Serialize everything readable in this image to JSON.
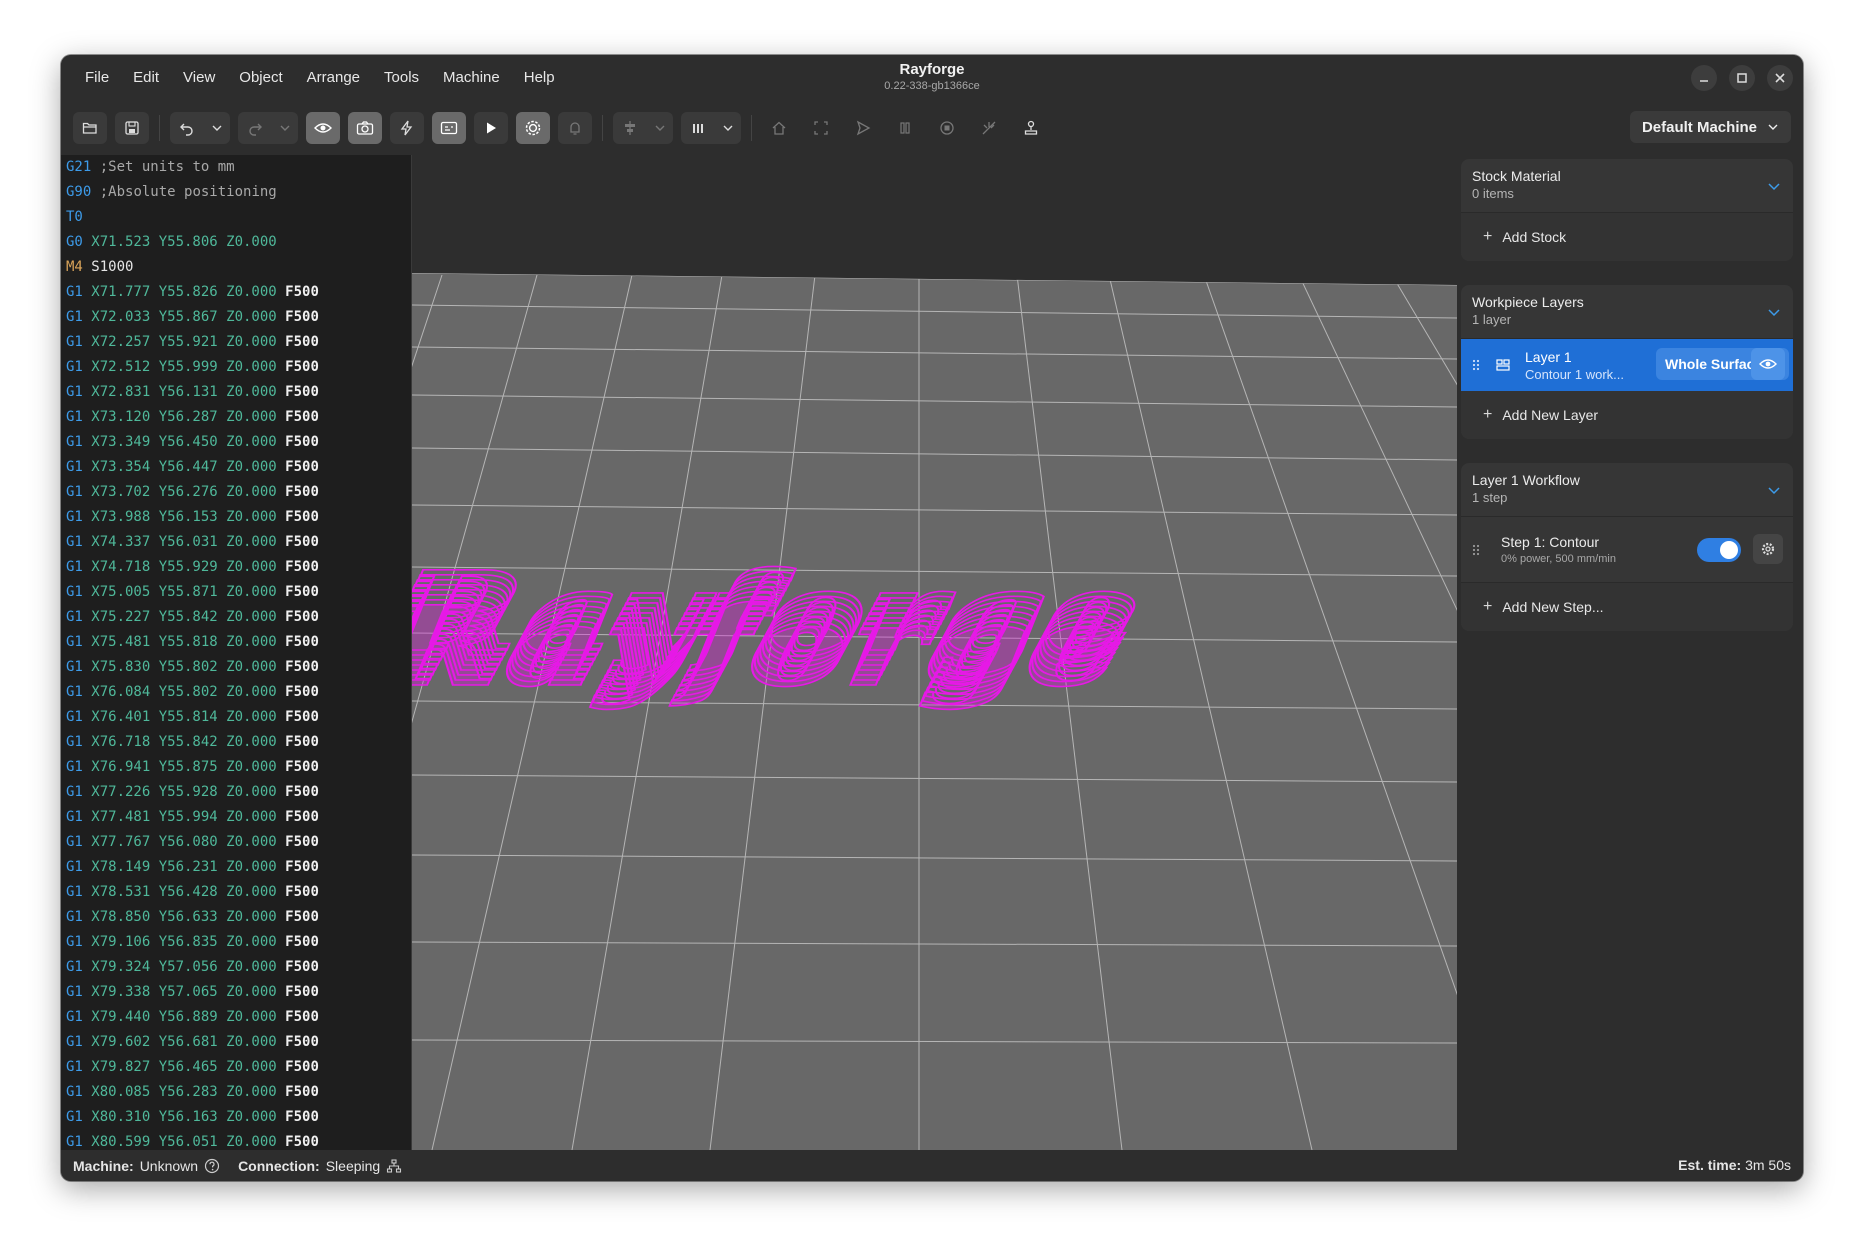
{
  "window": {
    "title": "Rayforge",
    "subtitle": "0.22-338-gb1366ce"
  },
  "menu": [
    "File",
    "Edit",
    "View",
    "Object",
    "Arrange",
    "Tools",
    "Machine",
    "Help"
  ],
  "toolbar": {
    "machine_select": "Default Machine"
  },
  "gcode": {
    "lines": [
      {
        "cmd": "G21",
        "cmd_color": "blue",
        "rest": " ;Set units to mm",
        "rest_color": "gray",
        "feed": ""
      },
      {
        "cmd": "G90",
        "cmd_color": "blue",
        "rest": " ;Absolute positioning",
        "rest_color": "gray",
        "feed": ""
      },
      {
        "cmd": "T0",
        "cmd_color": "blue",
        "rest": "",
        "rest_color": "green",
        "feed": ""
      },
      {
        "cmd": "G0",
        "cmd_color": "blue",
        "rest": " X71.523 Y55.806 Z0.000",
        "rest_color": "green",
        "feed": ""
      },
      {
        "cmd": "M4",
        "cmd_color": "orange",
        "rest": " S1000",
        "rest_color": "plain",
        "feed": ""
      },
      {
        "cmd": "G1",
        "cmd_color": "blue",
        "rest": " X71.777 Y55.826 Z0.000",
        "rest_color": "green",
        "feed": " F500"
      },
      {
        "cmd": "G1",
        "cmd_color": "blue",
        "rest": " X72.033 Y55.867 Z0.000",
        "rest_color": "green",
        "feed": " F500"
      },
      {
        "cmd": "G1",
        "cmd_color": "blue",
        "rest": " X72.257 Y55.921 Z0.000",
        "rest_color": "green",
        "feed": " F500"
      },
      {
        "cmd": "G1",
        "cmd_color": "blue",
        "rest": " X72.512 Y55.999 Z0.000",
        "rest_color": "green",
        "feed": " F500"
      },
      {
        "cmd": "G1",
        "cmd_color": "blue",
        "rest": " X72.831 Y56.131 Z0.000",
        "rest_color": "green",
        "feed": " F500"
      },
      {
        "cmd": "G1",
        "cmd_color": "blue",
        "rest": " X73.120 Y56.287 Z0.000",
        "rest_color": "green",
        "feed": " F500"
      },
      {
        "cmd": "G1",
        "cmd_color": "blue",
        "rest": " X73.349 Y56.450 Z0.000",
        "rest_color": "green",
        "feed": " F500"
      },
      {
        "cmd": "G1",
        "cmd_color": "blue",
        "rest": " X73.354 Y56.447 Z0.000",
        "rest_color": "green",
        "feed": " F500"
      },
      {
        "cmd": "G1",
        "cmd_color": "blue",
        "rest": " X73.702 Y56.276 Z0.000",
        "rest_color": "green",
        "feed": " F500"
      },
      {
        "cmd": "G1",
        "cmd_color": "blue",
        "rest": " X73.988 Y56.153 Z0.000",
        "rest_color": "green",
        "feed": " F500"
      },
      {
        "cmd": "G1",
        "cmd_color": "blue",
        "rest": " X74.337 Y56.031 Z0.000",
        "rest_color": "green",
        "feed": " F500"
      },
      {
        "cmd": "G1",
        "cmd_color": "blue",
        "rest": " X74.718 Y55.929 Z0.000",
        "rest_color": "green",
        "feed": " F500"
      },
      {
        "cmd": "G1",
        "cmd_color": "blue",
        "rest": " X75.005 Y55.871 Z0.000",
        "rest_color": "green",
        "feed": " F500"
      },
      {
        "cmd": "G1",
        "cmd_color": "blue",
        "rest": " X75.227 Y55.842 Z0.000",
        "rest_color": "green",
        "feed": " F500"
      },
      {
        "cmd": "G1",
        "cmd_color": "blue",
        "rest": " X75.481 Y55.818 Z0.000",
        "rest_color": "green",
        "feed": " F500"
      },
      {
        "cmd": "G1",
        "cmd_color": "blue",
        "rest": " X75.830 Y55.802 Z0.000",
        "rest_color": "green",
        "feed": " F500"
      },
      {
        "cmd": "G1",
        "cmd_color": "blue",
        "rest": " X76.084 Y55.802 Z0.000",
        "rest_color": "green",
        "feed": " F500"
      },
      {
        "cmd": "G1",
        "cmd_color": "blue",
        "rest": " X76.401 Y55.814 Z0.000",
        "rest_color": "green",
        "feed": " F500"
      },
      {
        "cmd": "G1",
        "cmd_color": "blue",
        "rest": " X76.718 Y55.842 Z0.000",
        "rest_color": "green",
        "feed": " F500"
      },
      {
        "cmd": "G1",
        "cmd_color": "blue",
        "rest": " X76.941 Y55.875 Z0.000",
        "rest_color": "green",
        "feed": " F500"
      },
      {
        "cmd": "G1",
        "cmd_color": "blue",
        "rest": " X77.226 Y55.928 Z0.000",
        "rest_color": "green",
        "feed": " F500"
      },
      {
        "cmd": "G1",
        "cmd_color": "blue",
        "rest": " X77.481 Y55.994 Z0.000",
        "rest_color": "green",
        "feed": " F500"
      },
      {
        "cmd": "G1",
        "cmd_color": "blue",
        "rest": " X77.767 Y56.080 Z0.000",
        "rest_color": "green",
        "feed": " F500"
      },
      {
        "cmd": "G1",
        "cmd_color": "blue",
        "rest": " X78.149 Y56.231 Z0.000",
        "rest_color": "green",
        "feed": " F500"
      },
      {
        "cmd": "G1",
        "cmd_color": "blue",
        "rest": " X78.531 Y56.428 Z0.000",
        "rest_color": "green",
        "feed": " F500"
      },
      {
        "cmd": "G1",
        "cmd_color": "blue",
        "rest": " X78.850 Y56.633 Z0.000",
        "rest_color": "green",
        "feed": " F500"
      },
      {
        "cmd": "G1",
        "cmd_color": "blue",
        "rest": " X79.106 Y56.835 Z0.000",
        "rest_color": "green",
        "feed": " F500"
      },
      {
        "cmd": "G1",
        "cmd_color": "blue",
        "rest": " X79.324 Y57.056 Z0.000",
        "rest_color": "green",
        "feed": " F500"
      },
      {
        "cmd": "G1",
        "cmd_color": "blue",
        "rest": " X79.338 Y57.065 Z0.000",
        "rest_color": "green",
        "feed": " F500"
      },
      {
        "cmd": "G1",
        "cmd_color": "blue",
        "rest": " X79.440 Y56.889 Z0.000",
        "rest_color": "green",
        "feed": " F500"
      },
      {
        "cmd": "G1",
        "cmd_color": "blue",
        "rest": " X79.602 Y56.681 Z0.000",
        "rest_color": "green",
        "feed": " F500"
      },
      {
        "cmd": "G1",
        "cmd_color": "blue",
        "rest": " X79.827 Y56.465 Z0.000",
        "rest_color": "green",
        "feed": " F500"
      },
      {
        "cmd": "G1",
        "cmd_color": "blue",
        "rest": " X80.085 Y56.283 Z0.000",
        "rest_color": "green",
        "feed": " F500"
      },
      {
        "cmd": "G1",
        "cmd_color": "blue",
        "rest": " X80.310 Y56.163 Z0.000",
        "rest_color": "green",
        "feed": " F500"
      },
      {
        "cmd": "G1",
        "cmd_color": "blue",
        "rest": " X80.599 Y56.051 Z0.000",
        "rest_color": "green",
        "feed": " F500"
      }
    ]
  },
  "viewport": {
    "preview_color": "#e619e6",
    "preview_text": "Rayforge",
    "surface_color": "#686868",
    "grid_color": "#cfcfcf"
  },
  "panels": {
    "stock": {
      "title": "Stock Material",
      "subtitle": "0 items",
      "add_label": "Add Stock"
    },
    "layers": {
      "title": "Workpiece Layers",
      "subtitle": "1 layer",
      "layer_name": "Layer 1",
      "layer_desc": "Contour 1 work...",
      "surface_mode": "Whole Surface",
      "add_label": "Add New Layer"
    },
    "workflow": {
      "title": "Layer 1 Workflow",
      "subtitle": "1 step",
      "step_name": "Step 1: Contour",
      "step_desc": "0% power, 500 mm/min",
      "step_enabled": true,
      "add_label": "Add New Step..."
    }
  },
  "status": {
    "machine_label": "Machine:",
    "machine_value": "Unknown",
    "connection_label": "Connection:",
    "connection_value": "Sleeping",
    "est_label": "Est. time:",
    "est_value": "3m 50s"
  },
  "colors": {
    "accent": "#1f6fd6",
    "keyword_blue": "#3d9be9",
    "coord_green": "#4fb89a",
    "m_orange": "#d9a45a"
  }
}
